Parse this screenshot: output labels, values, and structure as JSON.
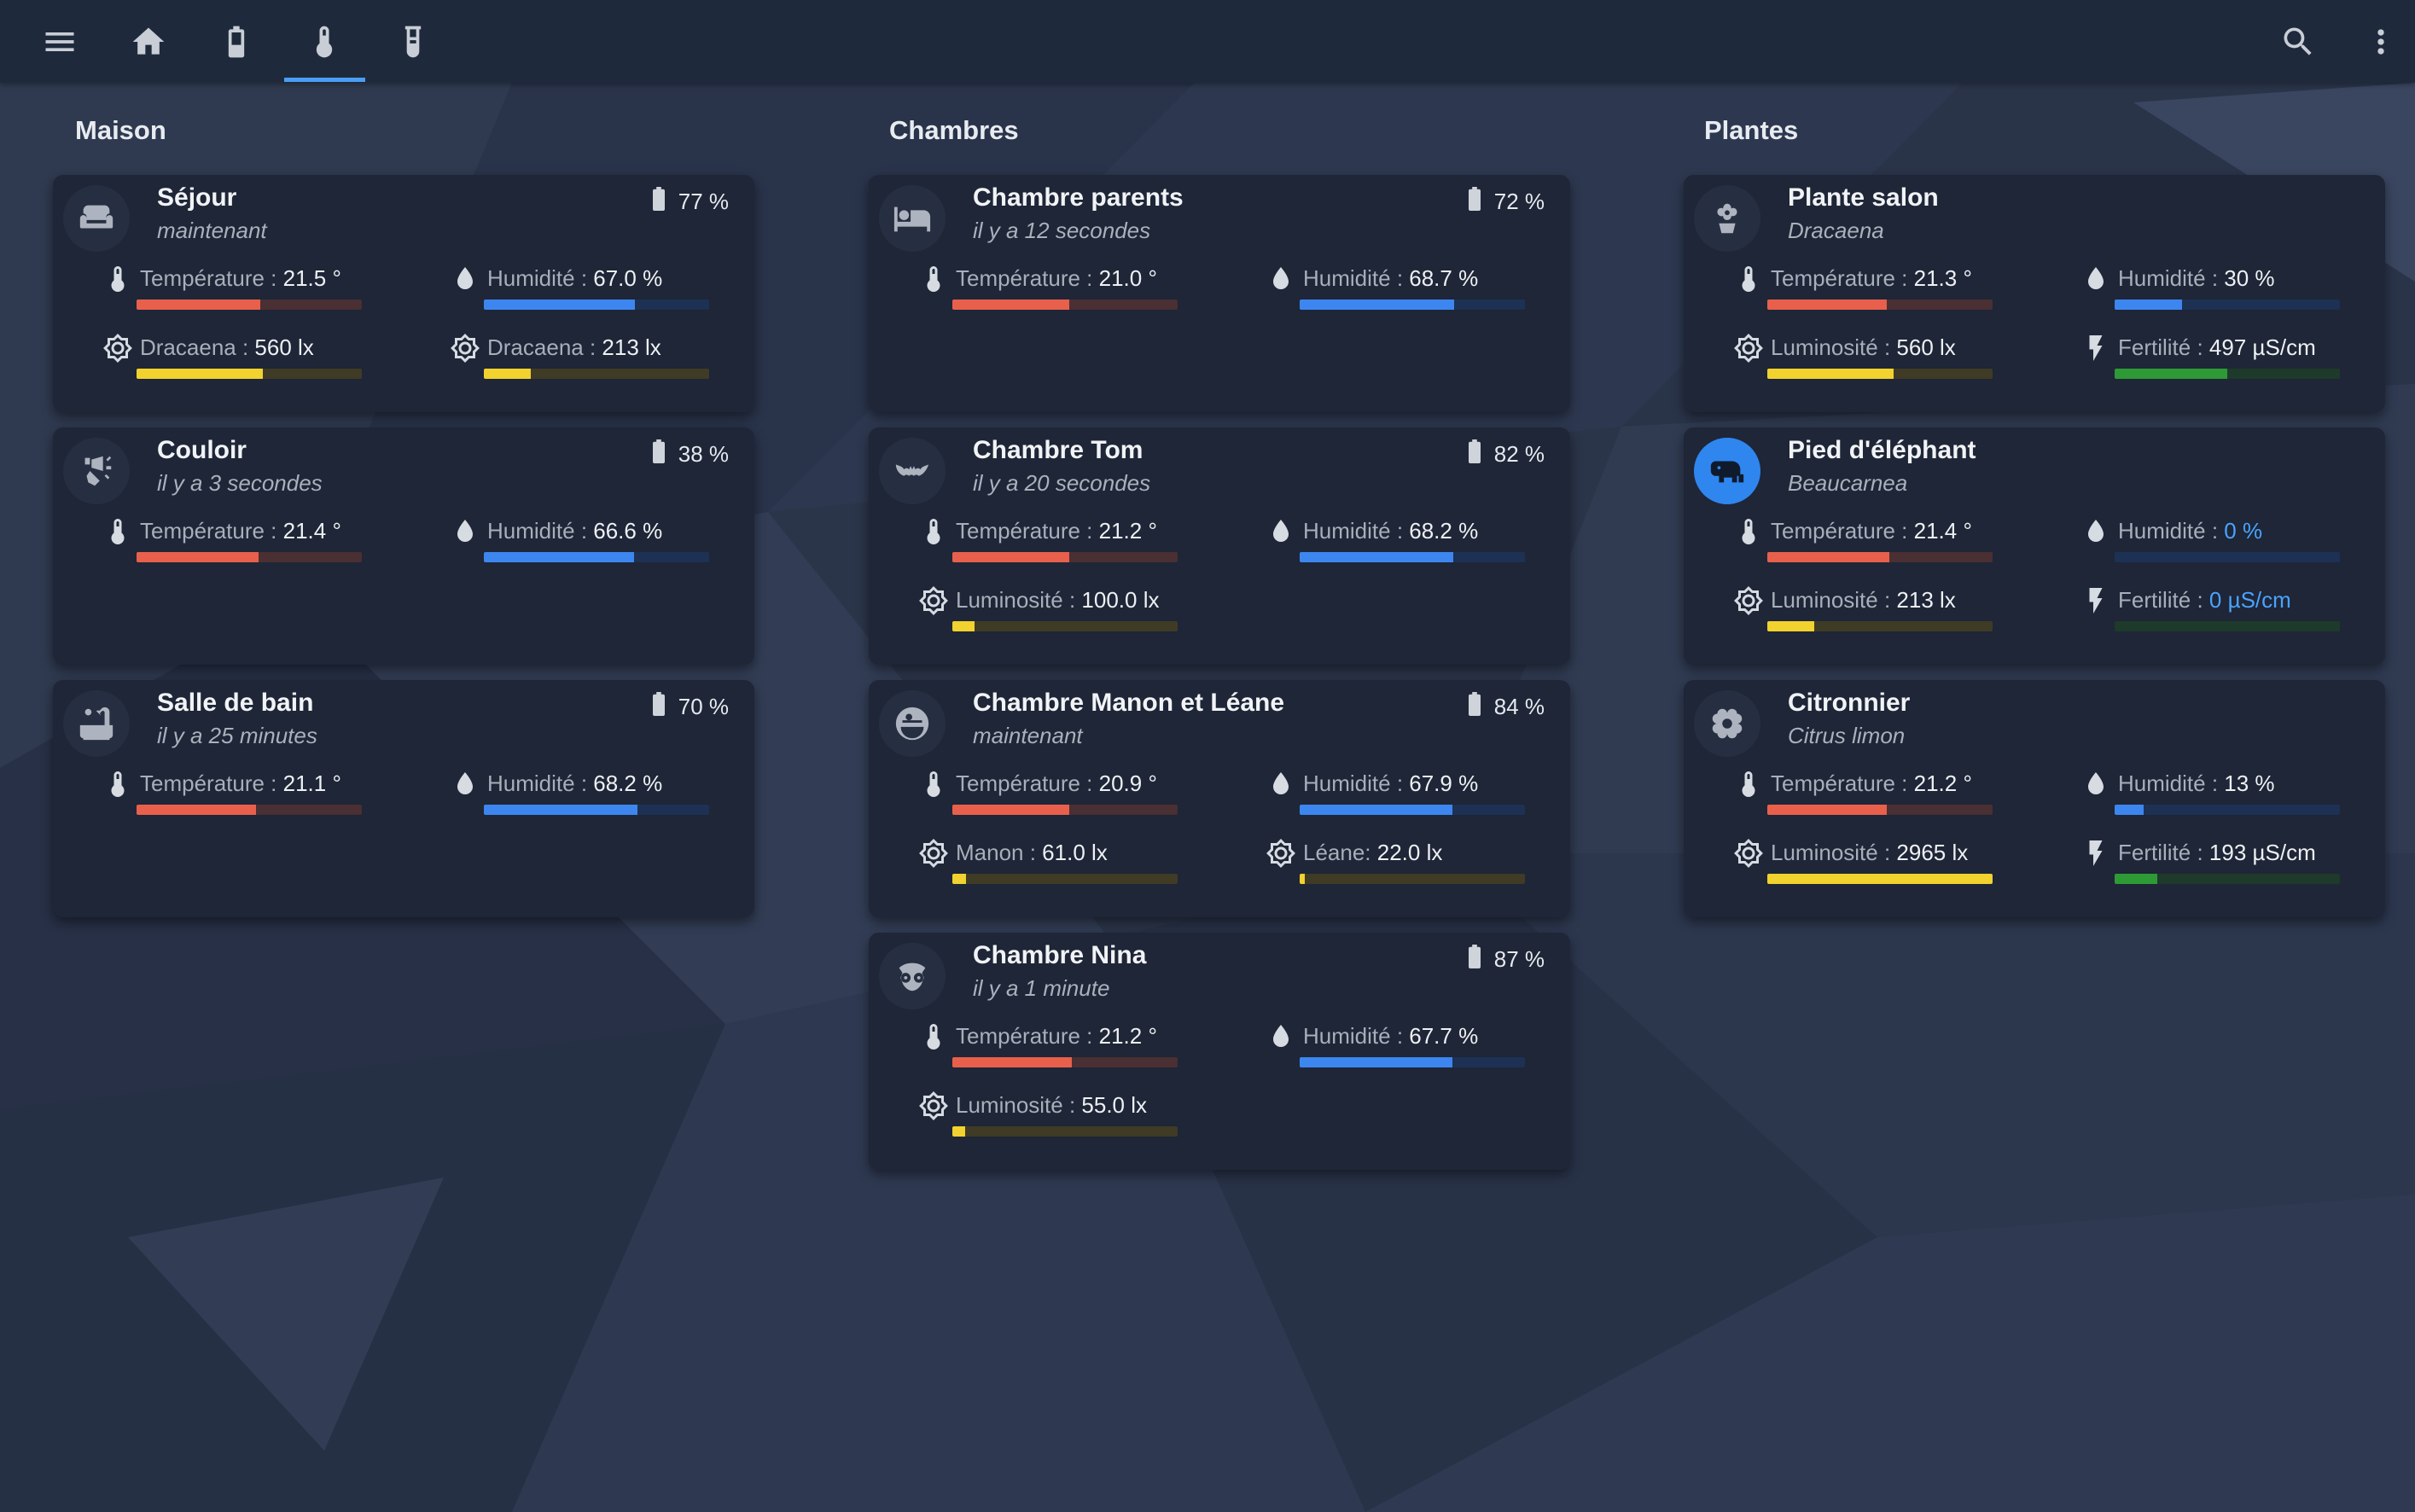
{
  "colors": {
    "temperature": "#e8604c",
    "temperature_track": "#4a2f33",
    "humidity": "#3d86f0",
    "humidity_track": "#1d3154",
    "light": "#f2d22e",
    "light_track": "#3f3b25",
    "fertility": "#2e9a36",
    "fertility_track": "#1e3a2a",
    "tab_accent": "#4a9ff5"
  },
  "topbar": {
    "left_icons": [
      "menu-icon",
      "home-icon",
      "battery-tab-icon",
      "thermometer-tab-icon",
      "test-tube-tab-icon"
    ],
    "active_tab": "thermometer-tab-icon",
    "right_icons": [
      "search-icon",
      "more-vert-icon"
    ]
  },
  "sections": [
    {
      "title": "Maison",
      "cards": [
        {
          "icon": "sofa-icon",
          "title": "Séjour",
          "subtitle": "maintenant",
          "battery": "77 %",
          "metrics": [
            {
              "icon": "thermometer-icon",
              "label": "Température : ",
              "value": "21.5 °",
              "kind": "temperature",
              "fill": 0.55
            },
            {
              "icon": "water-drop-icon",
              "label": "Humidité : ",
              "value": "67.0 %",
              "kind": "humidity",
              "fill": 0.67
            },
            {
              "icon": "sun-icon",
              "label": "Dracaena : ",
              "value": "560 lx",
              "kind": "light",
              "fill": 0.56
            },
            {
              "icon": "sun-icon",
              "label": "Dracaena : ",
              "value": "213 lx",
              "kind": "light",
              "fill": 0.21
            }
          ]
        },
        {
          "icon": "wall-light-icon",
          "title": "Couloir",
          "subtitle": "il y a 3 secondes",
          "battery": "38 %",
          "metrics": [
            {
              "icon": "thermometer-icon",
              "label": "Température : ",
              "value": "21.4 °",
              "kind": "temperature",
              "fill": 0.54
            },
            {
              "icon": "water-drop-icon",
              "label": "Humidité : ",
              "value": "66.6 %",
              "kind": "humidity",
              "fill": 0.666
            }
          ]
        },
        {
          "icon": "bathtub-icon",
          "title": "Salle de bain",
          "subtitle": "il y a 25 minutes",
          "battery": "70 %",
          "metrics": [
            {
              "icon": "thermometer-icon",
              "label": "Température : ",
              "value": "21.1 °",
              "kind": "temperature",
              "fill": 0.53
            },
            {
              "icon": "water-drop-icon",
              "label": "Humidité : ",
              "value": "68.2 %",
              "kind": "humidity",
              "fill": 0.682
            }
          ]
        }
      ]
    },
    {
      "title": "Chambres",
      "cards": [
        {
          "icon": "bed-icon",
          "title": "Chambre parents",
          "subtitle": "il y a 12 secondes",
          "battery": "72 %",
          "metrics": [
            {
              "icon": "thermometer-icon",
              "label": "Température : ",
              "value": "21.0 °",
              "kind": "temperature",
              "fill": 0.52
            },
            {
              "icon": "water-drop-icon",
              "label": "Humidité : ",
              "value": "68.7 %",
              "kind": "humidity",
              "fill": 0.687
            }
          ]
        },
        {
          "icon": "bat-icon",
          "title": "Chambre Tom",
          "subtitle": "il y a 20 secondes",
          "battery": "82 %",
          "metrics": [
            {
              "icon": "thermometer-icon",
              "label": "Température : ",
              "value": "21.2 °",
              "kind": "temperature",
              "fill": 0.52
            },
            {
              "icon": "water-drop-icon",
              "label": "Humidité : ",
              "value": "68.2 %",
              "kind": "humidity",
              "fill": 0.682
            },
            {
              "icon": "sun-icon",
              "label": "Luminosité : ",
              "value": "100.0 lx",
              "kind": "light",
              "fill": 0.1
            }
          ]
        },
        {
          "icon": "death-star-icon",
          "title": "Chambre Manon et Léane",
          "subtitle": "maintenant",
          "battery": "84 %",
          "metrics": [
            {
              "icon": "thermometer-icon",
              "label": "Température : ",
              "value": "20.9 °",
              "kind": "temperature",
              "fill": 0.52
            },
            {
              "icon": "water-drop-icon",
              "label": "Humidité : ",
              "value": "67.9 %",
              "kind": "humidity",
              "fill": 0.679
            },
            {
              "icon": "sun-icon",
              "label": "Manon : ",
              "value": "61.0 lx",
              "kind": "light",
              "fill": 0.06
            },
            {
              "icon": "sun-icon",
              "label": "Léane: ",
              "value": "22.0 lx",
              "kind": "light",
              "fill": 0.022
            }
          ]
        },
        {
          "icon": "owl-icon",
          "title": "Chambre Nina",
          "subtitle": "il y a 1 minute",
          "battery": "87 %",
          "metrics": [
            {
              "icon": "thermometer-icon",
              "label": "Température : ",
              "value": "21.2 °",
              "kind": "temperature",
              "fill": 0.53
            },
            {
              "icon": "water-drop-icon",
              "label": "Humidité : ",
              "value": "67.7 %",
              "kind": "humidity",
              "fill": 0.677
            },
            {
              "icon": "sun-icon",
              "label": "Luminosité : ",
              "value": "55.0 lx",
              "kind": "light",
              "fill": 0.055
            }
          ]
        }
      ]
    },
    {
      "title": "Plantes",
      "cards": [
        {
          "icon": "flower-pot-icon",
          "title": "Plante salon",
          "subtitle": "Dracaena",
          "metrics": [
            {
              "icon": "thermometer-icon",
              "label": "Température : ",
              "value": "21.3 °",
              "kind": "temperature",
              "fill": 0.53
            },
            {
              "icon": "water-drop-icon",
              "label": "Humidité : ",
              "value": "30 %",
              "kind": "humidity",
              "fill": 0.3
            },
            {
              "icon": "sun-icon",
              "label": "Luminosité : ",
              "value": "560 lx",
              "kind": "light",
              "fill": 0.56
            },
            {
              "icon": "flash-icon",
              "label": "Fertilité : ",
              "value": "497 µS/cm",
              "kind": "fertility",
              "fill": 0.5
            }
          ]
        },
        {
          "icon": "elephant-icon",
          "title": "Pied d'éléphant",
          "subtitle": "Beaucarnea",
          "avatar_active": true,
          "metrics": [
            {
              "icon": "thermometer-icon",
              "label": "Température : ",
              "value": "21.4 °",
              "kind": "temperature",
              "fill": 0.54
            },
            {
              "icon": "water-drop-icon",
              "label": "Humidité : ",
              "value": "0 %",
              "kind": "humidity",
              "fill": 0,
              "value_link": true
            },
            {
              "icon": "sun-icon",
              "label": "Luminosité : ",
              "value": "213 lx",
              "kind": "light",
              "fill": 0.21
            },
            {
              "icon": "flash-icon",
              "label": "Fertilité : ",
              "value": "0 µS/cm",
              "kind": "fertility",
              "fill": 0,
              "value_link": true
            }
          ]
        },
        {
          "icon": "flower-icon",
          "title": "Citronnier",
          "subtitle": "Citrus limon",
          "metrics": [
            {
              "icon": "thermometer-icon",
              "label": "Température : ",
              "value": "21.2 °",
              "kind": "temperature",
              "fill": 0.53
            },
            {
              "icon": "water-drop-icon",
              "label": "Humidité : ",
              "value": "13 %",
              "kind": "humidity",
              "fill": 0.13
            },
            {
              "icon": "sun-icon",
              "label": "Luminosité : ",
              "value": "2965 lx",
              "kind": "light",
              "fill": 1.0
            },
            {
              "icon": "flash-icon",
              "label": "Fertilité : ",
              "value": "193 µS/cm",
              "kind": "fertility",
              "fill": 0.19
            }
          ]
        }
      ]
    }
  ]
}
